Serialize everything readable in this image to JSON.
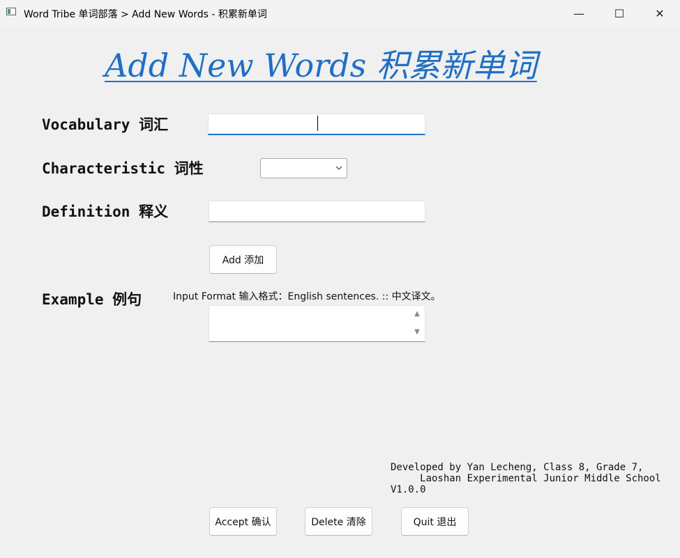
{
  "window": {
    "title": "Word Tribe 单词部落 > Add New Words - 积累新单词",
    "minimize_glyph": "—",
    "maximize_glyph": "☐",
    "close_glyph": "✕"
  },
  "heading": "Add New Words 积累新单词",
  "form": {
    "vocabulary_label": "Vocabulary 词汇",
    "vocabulary_value": "",
    "characteristic_label": "Characteristic 词性",
    "characteristic_value": "",
    "definition_label": "Definition 释义",
    "definition_value": "",
    "add_button": "Add 添加",
    "example_label": "Example 例句",
    "example_hint": "Input Format 输入格式：English sentences. :: 中文译文。",
    "example_value": ""
  },
  "credits": {
    "line1": "Developed by Yan Lecheng, Class 8, Grade 7,",
    "line2": "     Laoshan Experimental Junior Middle School",
    "line3": "V1.0.0"
  },
  "footer": {
    "accept_button": "Accept 确认",
    "delete_button": "Delete 清除",
    "quit_button": "Quit 退出"
  },
  "icons": {
    "app": "app-window-icon",
    "dropdown": "chevron-down-icon",
    "scroll_up": "triangle-up-icon",
    "scroll_down": "triangle-down-icon"
  },
  "colors": {
    "accent": "#1f6fc5",
    "background": "#f0f0f0"
  }
}
